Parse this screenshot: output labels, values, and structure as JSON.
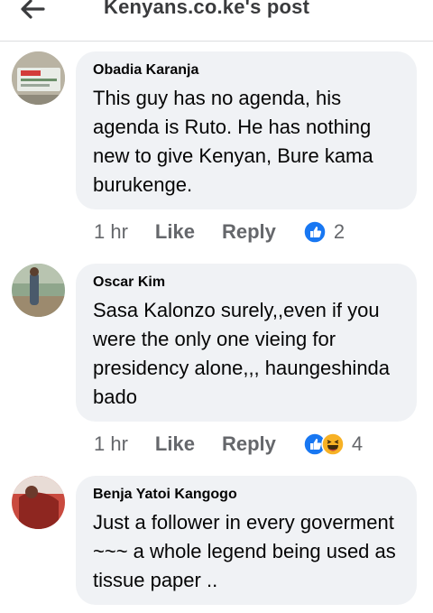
{
  "header": {
    "title": "Kenyans.co.ke's post"
  },
  "icons": {
    "back": "arrow-left-icon",
    "like": "like-reaction-icon",
    "haha": "haha-reaction-icon"
  },
  "colors": {
    "bubble": "#f0f2f5",
    "like_blue": "#1877f2",
    "haha_yellow": "#f7b125",
    "meta_gray": "#65676b"
  },
  "comments": [
    {
      "author": "Obadia Karanja",
      "text": "This guy has no agenda, his agenda is Ruto. He has nothing new to give Kenyan,  Bure kama burukenge.",
      "time": "1 hr",
      "like_label": "Like",
      "reply_label": "Reply",
      "reactions": [
        "like"
      ],
      "reaction_count": "2"
    },
    {
      "author": "Oscar Kim",
      "text": "Sasa Kalonzo surely,,even if you were the only one vieing for presidency alone,,, haungeshinda bado",
      "time": "1 hr",
      "like_label": "Like",
      "reply_label": "Reply",
      "reactions": [
        "like",
        "haha"
      ],
      "reaction_count": "4"
    },
    {
      "author": "Benja Yatoi Kangogo",
      "text": "Just a follower in every goverment ~~~ a whole legend being used as tissue paper .."
    }
  ]
}
